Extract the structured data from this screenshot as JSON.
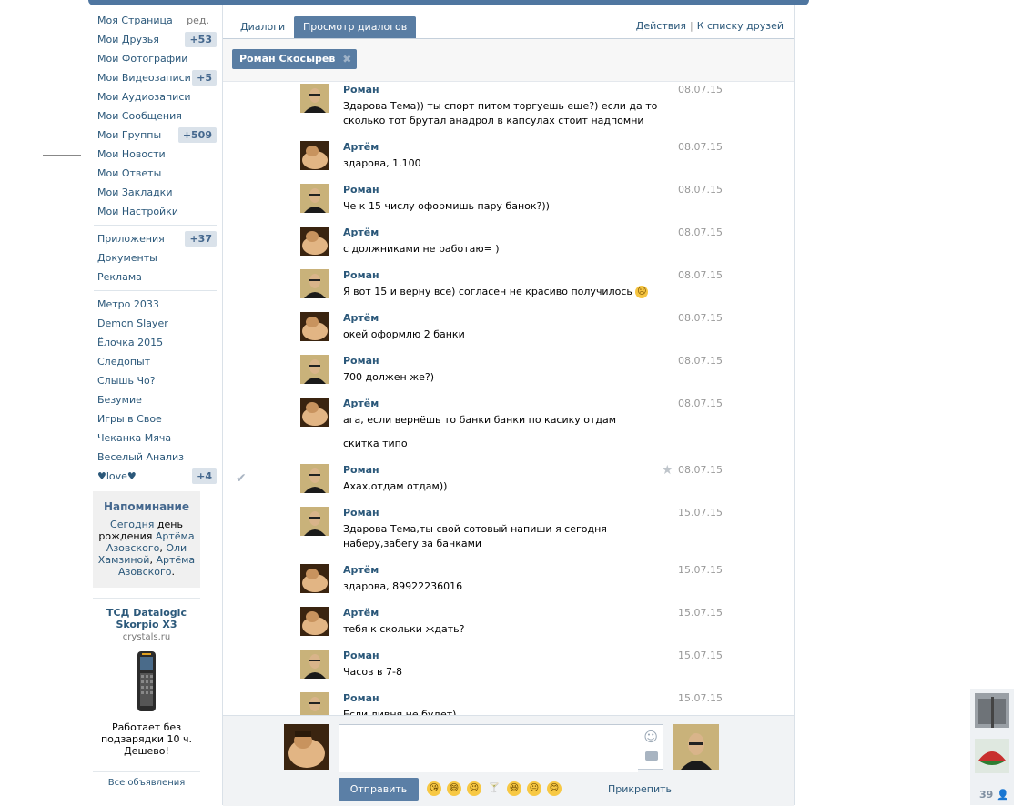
{
  "nav": {
    "edit_label": "ред.",
    "items": [
      {
        "label": "Моя Страница"
      },
      {
        "label": "Мои Друзья",
        "count": "+53"
      },
      {
        "label": "Мои Фотографии"
      },
      {
        "label": "Мои Видеозаписи",
        "count": "+5"
      },
      {
        "label": "Мои Аудиозаписи"
      },
      {
        "label": "Мои Сообщения"
      },
      {
        "label": "Мои Группы",
        "count": "+509"
      },
      {
        "label": "Мои Новости"
      },
      {
        "label": "Мои Ответы"
      },
      {
        "label": "Мои Закладки"
      },
      {
        "label": "Мои Настройки"
      }
    ],
    "apps": [
      {
        "label": "Приложения",
        "count": "+37"
      },
      {
        "label": "Документы"
      },
      {
        "label": "Реклама"
      }
    ],
    "games": [
      {
        "label": "Метро 2033"
      },
      {
        "label": "Demon Slayer"
      },
      {
        "label": "Ёлочка 2015"
      },
      {
        "label": "Следопыт"
      },
      {
        "label": "Слышь Чо?"
      },
      {
        "label": "Безумие"
      },
      {
        "label": "Игры в Свое"
      },
      {
        "label": "Чеканка Мяча"
      },
      {
        "label": "Веселый Анализ"
      },
      {
        "label": "♥love♥",
        "count": "+4"
      }
    ]
  },
  "reminder": {
    "title": "Напоминание",
    "today": "Сегодня",
    "middle": "день рождения",
    "name1": "Артёма Азовского",
    "comma": ",",
    "name2": "Оли Хамзиной",
    "name3": "Артёма Азовского",
    "dot": "."
  },
  "ad": {
    "title": "ТСД Datalogic Skorpio X3",
    "domain": "crystals.ru",
    "text": "Работает без подзарядки 10 ч. Дешево!",
    "all_ads": "Все объявления"
  },
  "tabs": {
    "dialogs": "Диалоги",
    "view_dialogs": "Просмотр диалогов",
    "actions": "Действия",
    "separator": "|",
    "to_friends": "К списку друзей"
  },
  "filter": {
    "chip_label": "Роман Скосырев",
    "chip_close": "✖"
  },
  "messages": [
    {
      "author": "Роман",
      "date": "08.07.15",
      "text": "Здарова Тема)) ты спорт питом торгуешь еще?) если да то сколько тот брутал анадрол в капсулах стоит надпомни"
    },
    {
      "author": "Артём",
      "date": "08.07.15",
      "text": "здарова, 1.100"
    },
    {
      "author": "Роман",
      "date": "08.07.15",
      "text": "Че к 15 числу оформишь пару банок?))"
    },
    {
      "author": "Артём",
      "date": "08.07.15",
      "text": "с должниками не работаю= )"
    },
    {
      "author": "Роман",
      "date": "08.07.15",
      "text": "Я вот 15 и верну все) согласен не красиво получилось"
    },
    {
      "author": "Артём",
      "date": "08.07.15",
      "text": "окей оформлю 2 банки"
    },
    {
      "author": "Роман",
      "date": "08.07.15",
      "text": "700 должен же?)"
    },
    {
      "author": "Артём",
      "date": "08.07.15",
      "text": "ага, если вернёшь то банки банки по касику отдам",
      "text2": "скитка типо"
    },
    {
      "author": "Роман",
      "date": "08.07.15",
      "text": "Ахах,отдам отдам))"
    },
    {
      "author": "Роман",
      "date": "15.07.15",
      "text": "Здарова Тема,ты свой сотовый напиши я сегодня наберу,забегу за банками"
    },
    {
      "author": "Артём",
      "date": "15.07.15",
      "text": "здарова, 89922236016"
    },
    {
      "author": "Артём",
      "date": "15.07.15",
      "text": "тебя к скольки ждать?"
    },
    {
      "author": "Роман",
      "date": "15.07.15",
      "text": "Часов в 7-8"
    },
    {
      "author": "Роман",
      "date": "15.07.15",
      "text": "Если ливня не будет)"
    }
  ],
  "composer": {
    "send": "Отправить",
    "attach": "Прикрепить"
  },
  "right_panel": {
    "count": "39"
  },
  "icons": {
    "check": "check-icon",
    "star": "star-icon",
    "smile": "smile-icon",
    "camera": "camera-icon",
    "user": "user-icon"
  },
  "colors": {
    "accent": "#597da3",
    "link": "#2b587a",
    "topbar": "#4f76a0"
  }
}
